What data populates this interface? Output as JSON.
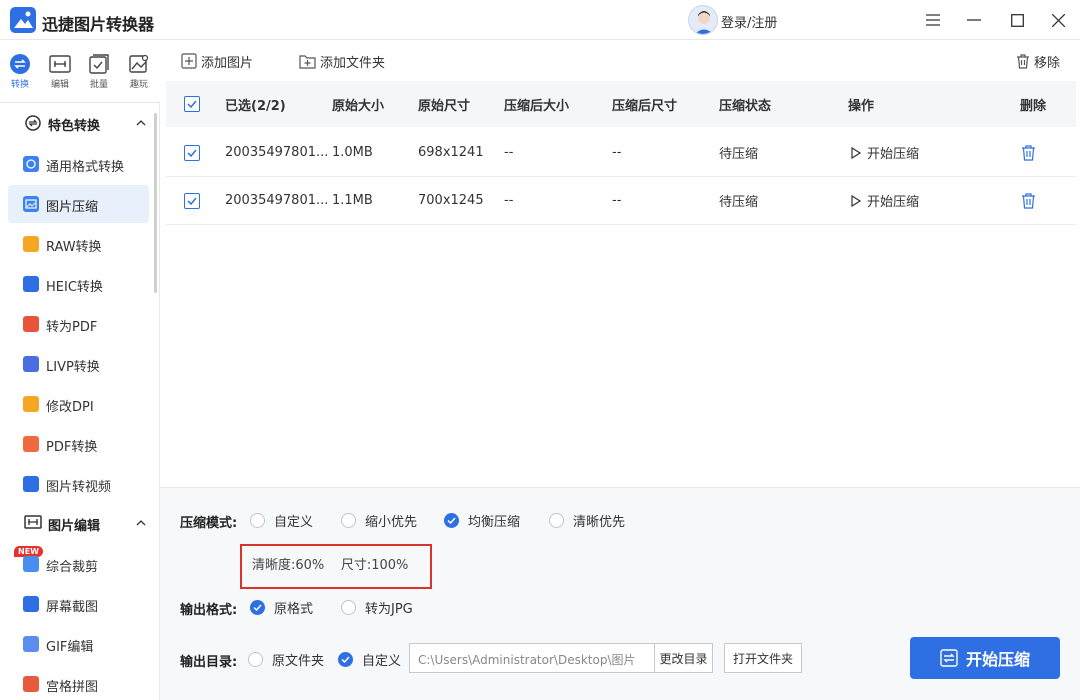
{
  "app": {
    "title": "迅捷图片转换器",
    "login": "登录/注册"
  },
  "icon_tabs": [
    {
      "label": "转换",
      "icon": "convert-icon",
      "active": true
    },
    {
      "label": "编辑",
      "icon": "edit-icon"
    },
    {
      "label": "批量",
      "icon": "batch-icon"
    },
    {
      "label": "趣玩",
      "icon": "fun-icon"
    }
  ],
  "sidebar": {
    "group1": {
      "label": "特色转换",
      "icon": "feature-convert-icon"
    },
    "items1": [
      {
        "label": "通用格式转换",
        "icon": "general-format-icon",
        "color": "#3b82f6"
      },
      {
        "label": "图片压缩",
        "icon": "image-compress-icon",
        "color": "#3b82f6",
        "active": true
      },
      {
        "label": "RAW转换",
        "icon": "raw-icon",
        "color": "#f5a623"
      },
      {
        "label": "HEIC转换",
        "icon": "heic-icon",
        "color": "#2f6fe4"
      },
      {
        "label": "转为PDF",
        "icon": "pdf-icon",
        "color": "#e8533c"
      },
      {
        "label": "LIVP转换",
        "icon": "livp-icon",
        "color": "#4a6ee0"
      },
      {
        "label": "修改DPI",
        "icon": "dpi-icon",
        "color": "#f5a623"
      },
      {
        "label": "PDF转换",
        "icon": "pdf-convert-icon",
        "color": "#ef6a3c"
      },
      {
        "label": "图片转视频",
        "icon": "image-to-video-icon",
        "color": "#2f6fe4"
      }
    ],
    "group2": {
      "label": "图片编辑",
      "icon": "image-edit-icon"
    },
    "items2": [
      {
        "label": "综合裁剪",
        "icon": "crop-icon",
        "color": "#4a8df0",
        "badge": "NEW"
      },
      {
        "label": "屏幕截图",
        "icon": "screenshot-icon",
        "color": "#2f6fe4"
      },
      {
        "label": "GIF编辑",
        "icon": "gif-icon",
        "color": "#5b8def"
      },
      {
        "label": "宫格拼图",
        "icon": "grid-collage-icon",
        "color": "#e85a3c"
      }
    ]
  },
  "toolbar": {
    "add_image": "添加图片",
    "add_folder": "添加文件夹",
    "remove": "移除"
  },
  "table": {
    "headers": {
      "selected": "已选(2/2)",
      "orig_size": "原始大小",
      "orig_dim": "原始尺寸",
      "comp_size": "压缩后大小",
      "comp_dim": "压缩后尺寸",
      "status": "压缩状态",
      "action": "操作",
      "delete": "删除"
    },
    "rows": [
      {
        "name": "20035497801...",
        "orig_size": "1.0MB",
        "orig_dim": "698x1241",
        "comp_size": "--",
        "comp_dim": "--",
        "status": "待压缩",
        "action": "开始压缩"
      },
      {
        "name": "20035497801...",
        "orig_size": "1.1MB",
        "orig_dim": "700x1245",
        "comp_size": "--",
        "comp_dim": "--",
        "status": "待压缩",
        "action": "开始压缩"
      }
    ]
  },
  "settings": {
    "mode_label": "压缩模式:",
    "modes": [
      "自定义",
      "缩小优先",
      "均衡压缩",
      "清晰优先"
    ],
    "mode_selected": "均衡压缩",
    "clarity": "清晰度:60%",
    "size": "尺寸:100%",
    "format_label": "输出格式:",
    "formats": [
      "原格式",
      "转为JPG"
    ],
    "format_selected": "原格式",
    "dir_label": "输出目录:",
    "dirs": [
      "原文件夹",
      "自定义"
    ],
    "dir_selected": "自定义",
    "path": "C:\\Users\\Administrator\\Desktop\\图片",
    "change_dir": "更改目录",
    "open_folder": "打开文件夹",
    "start": "开始压缩"
  },
  "colors": {
    "accent": "#2f6fe4",
    "highlight_box": "#d9342b"
  }
}
